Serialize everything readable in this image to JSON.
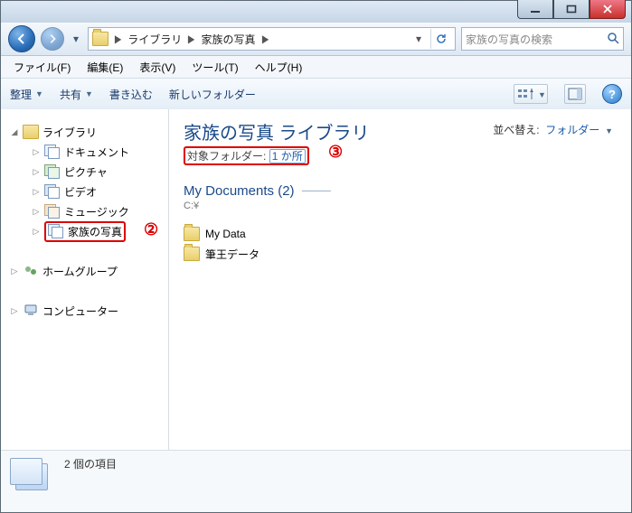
{
  "window": {
    "minimize_label": "minimize",
    "maximize_label": "maximize",
    "close_label": "close"
  },
  "address": {
    "root": "ライブラリ",
    "current": "家族の写真"
  },
  "search": {
    "placeholder": "家族の写真の検索"
  },
  "menus": {
    "file": "ファイル(F)",
    "edit": "編集(E)",
    "view": "表示(V)",
    "tools": "ツール(T)",
    "help": "ヘルプ(H)"
  },
  "toolbar": {
    "organize": "整理",
    "share": "共有",
    "burn": "書き込む",
    "new_folder": "新しいフォルダー"
  },
  "sidebar": {
    "libraries": "ライブラリ",
    "items": [
      {
        "label": "ドキュメント"
      },
      {
        "label": "ピクチャ"
      },
      {
        "label": "ビデオ"
      },
      {
        "label": "ミュージック"
      },
      {
        "label": "家族の写真"
      }
    ],
    "homegroup": "ホームグループ",
    "computer": "コンピューター"
  },
  "annotations": {
    "a2": "②",
    "a3": "③"
  },
  "main": {
    "title": "家族の写真 ライブラリ",
    "targets_label": "対象フォルダー:",
    "targets_link": "1 か所",
    "sort_label": "並べ替え:",
    "sort_value": "フォルダー",
    "section_title": "My Documents (2)",
    "section_path": "C:¥",
    "files": [
      {
        "name": "My Data"
      },
      {
        "name": "筆王データ"
      }
    ]
  },
  "details": {
    "count_text": "2 個の項目"
  }
}
